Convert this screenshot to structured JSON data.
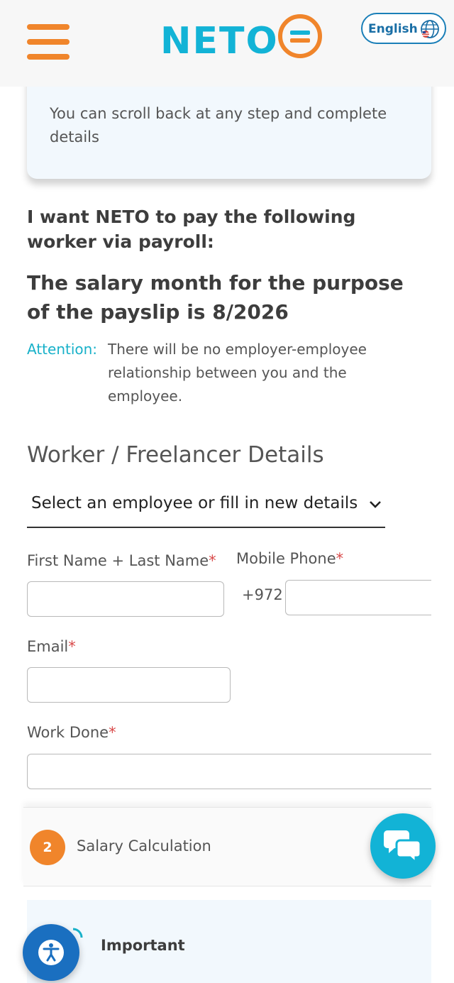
{
  "header": {
    "logo_text": "NETO",
    "language_label": "English",
    "colors": {
      "brand_orange": "#f0852b",
      "brand_cyan": "#12b3d6"
    }
  },
  "info_card": {
    "text": "You can scroll back at any step and complete details"
  },
  "intro": {
    "lead": "I want NETO to pay the following worker via payroll:",
    "salary_month": "The salary month for the purpose of the payslip is 8/2026",
    "attention_label": "Attention:",
    "attention_text": "There will be no employer-employee relationship between you and the employee."
  },
  "worker_form": {
    "section_title": "Worker / Freelancer Details",
    "employee_select": "Select an employee or fill in new details",
    "full_name_label": "First Name + Last Name",
    "mobile_label": "Mobile Phone",
    "country_code": "+972",
    "email_label": "Email",
    "work_done_label": "Work Done",
    "required_mark": "*",
    "full_name_value": "",
    "mobile_value": "",
    "email_value": "",
    "work_done_value": ""
  },
  "steps": [
    {
      "number": "2",
      "label": "Salary Calculation"
    }
  ],
  "important": {
    "label": "Important"
  },
  "floating": {
    "chat_icon": "chat-bubbles-icon",
    "accessibility_icon": "accessibility-icon"
  }
}
